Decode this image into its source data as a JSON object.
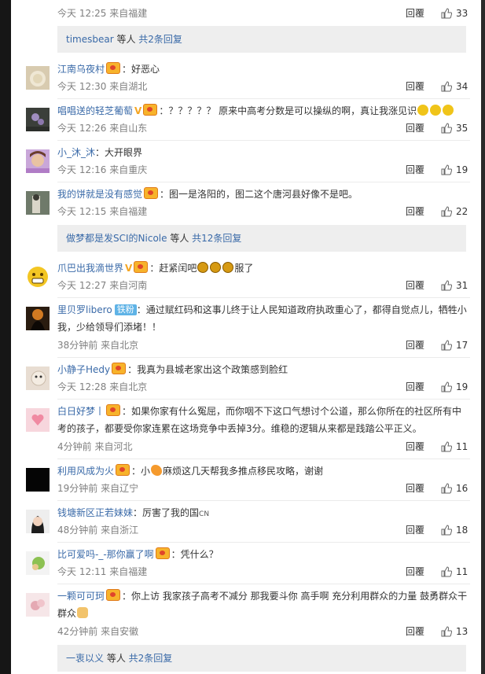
{
  "comments": [
    {
      "id": "c0",
      "time": "今天 12:25 来自福建",
      "reply": "回覆",
      "likes": "33"
    },
    {
      "id": "c1",
      "user": "江南乌夜村",
      "text": "：好恶心",
      "time": "今天 12:30 来自湖北",
      "reply": "回覆",
      "likes": "34"
    },
    {
      "id": "c2",
      "user": "唱唱送的轻芝葡萄",
      "text": "：？？？？？ 原来中高考分数是可以操纵的啊，真让我涨见识",
      "time": "今天 12:26 来自山东",
      "reply": "回覆",
      "likes": "35"
    },
    {
      "id": "c3",
      "user": "小_沐_沐",
      "text": "：大开眼界",
      "time": "今天 12:16 来自重庆",
      "reply": "回覆",
      "likes": "19"
    },
    {
      "id": "c4",
      "user": "我的饼就是没有感觉",
      "text": "：图一是洛阳的，图二这个唐河县好像不是吧。",
      "time": "今天 12:15 来自福建",
      "reply": "回覆",
      "likes": "22"
    },
    {
      "id": "c5",
      "user": "爪巴出我滴世界",
      "text_a": "：赶紧闰吧",
      "text_b": "服了",
      "time": "今天 12:27 来自河南",
      "reply": "回覆",
      "likes": "31"
    },
    {
      "id": "c6",
      "user": "里贝罗libero",
      "tag": "铁粉",
      "text_line1": "：通过赋红码和这事儿终于让人民知道政府执政重心了，都得自觉点儿，牺牲小",
      "text_line2": "我，少给领导们添堵！！",
      "time": "38分钟前 来自北京",
      "reply": "回覆",
      "likes": "17"
    },
    {
      "id": "c7",
      "user": "小静子Hedy",
      "text": "：我真为县城老家出这个政策感到脸红",
      "time": "今天 12:28 来自北京",
      "reply": "回覆",
      "likes": "19"
    },
    {
      "id": "c8",
      "user": "白日好梦丨",
      "text_line1": "：如果你家有什么冤屈，而你咽不下这口气想讨个公道，那么你所在的社区所有中",
      "text_line2": "考的孩子，都要受你家连累在这场竞争中丢掉3分。维稳的逻辑从来都是践踏公平正义。",
      "time": "4分钟前 来自河北",
      "reply": "回覆",
      "likes": "11"
    },
    {
      "id": "c9",
      "user": "利用风成为火",
      "text_a": "：小",
      "text_b": "麻烦这几天帮我多推点移民攻略，谢谢",
      "time": "19分钟前 来自辽宁",
      "reply": "回覆",
      "likes": "16"
    },
    {
      "id": "c10",
      "user": "钱塘新区正若妹妹",
      "text": "：厉害了我的国",
      "cn": "CN",
      "time": "48分钟前 来自浙江",
      "reply": "回覆",
      "likes": "18"
    },
    {
      "id": "c11",
      "user": "比可爱吗-_-那你赢了啊",
      "text": "：凭什么？",
      "time": "今天 12:11 来自福建",
      "reply": "回覆",
      "likes": "11"
    },
    {
      "id": "c12",
      "user": "一颗可可珂",
      "text_line1": "：你上访 我家孩子高考不减分 那我要斗你 高手啊 充分利用群众的力量 鼓勇群众干",
      "text_line2": "群众",
      "time": "42分钟前 来自安徽",
      "reply": "回覆",
      "likes": "13"
    }
  ],
  "more_replies": [
    {
      "user": "timesbear",
      "mid": " 等人 ",
      "count": "共2条回复"
    },
    {
      "user": "做梦都是发SCI的Nicole",
      "mid": " 等人 ",
      "count": "共12条回复"
    },
    {
      "user": "一衷以义",
      "mid": " 等人 ",
      "count": "共2条回复"
    }
  ],
  "icons": {
    "like": "thumbs-up-icon",
    "vip": "vip-badge-icon",
    "verified": "verified-v-icon"
  }
}
